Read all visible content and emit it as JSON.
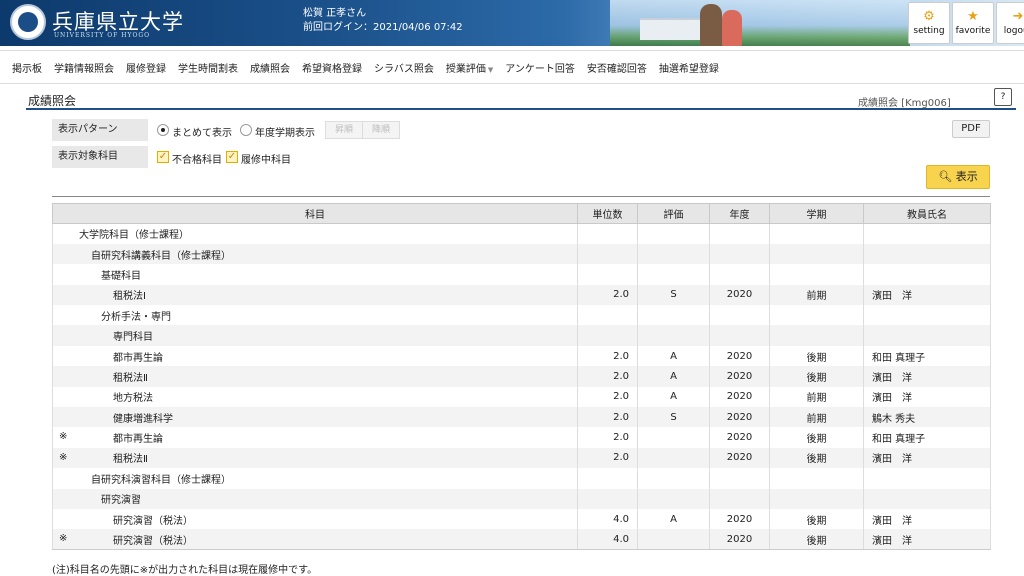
{
  "header": {
    "university": "兵庫県立大学",
    "university_sub": "UNIVERSITY OF HYOGO",
    "user_name": "松賀 正孝さん",
    "last_login": "前回ログイン：2021/04/06 07:42",
    "buttons": [
      {
        "label": "setting",
        "icon": "gear-icon"
      },
      {
        "label": "favorite",
        "icon": "star-icon"
      },
      {
        "label": "logout",
        "icon": "runner-icon"
      }
    ]
  },
  "nav": {
    "items": [
      "掲示板",
      "学籍情報照会",
      "履修登録",
      "学生時間割表",
      "成績照会",
      "希望資格登録",
      "シラバス照会",
      "授業評価",
      "アンケート回答",
      "安否確認回答",
      "抽選希望登録"
    ]
  },
  "page": {
    "title": "成績照会",
    "code": "成績照会 [Kmg006]"
  },
  "filters": {
    "pattern_label": "表示パターン",
    "opt_together": "まとめて表示",
    "opt_by_term": "年度学期表示",
    "asc": "昇順",
    "desc": "降順",
    "target_label": "表示対象科目",
    "chk_failed": "不合格科目",
    "chk_in_progress": "履修中科目",
    "pdf": "PDF",
    "show": "表示"
  },
  "table": {
    "headers": [
      "科目",
      "単位数",
      "評価",
      "年度",
      "学期",
      "教員氏名"
    ],
    "rows": [
      {
        "mark": "",
        "indent": 0,
        "subject": "大学院科目（修士課程）",
        "credits": "",
        "grade": "",
        "year": "",
        "term": "",
        "teacher": ""
      },
      {
        "mark": "",
        "indent": 1,
        "subject": "自研究科講義科目（修士課程）",
        "credits": "",
        "grade": "",
        "year": "",
        "term": "",
        "teacher": ""
      },
      {
        "mark": "",
        "indent": 2,
        "subject": "基礎科目",
        "credits": "",
        "grade": "",
        "year": "",
        "term": "",
        "teacher": ""
      },
      {
        "mark": "",
        "indent": 3,
        "subject": "租税法Ⅰ",
        "credits": "2.0",
        "grade": "S",
        "year": "2020",
        "term": "前期",
        "teacher": "濱田　洋"
      },
      {
        "mark": "",
        "indent": 2,
        "subject": "分析手法・専門",
        "credits": "",
        "grade": "",
        "year": "",
        "term": "",
        "teacher": ""
      },
      {
        "mark": "",
        "indent": 3,
        "subject": "専門科目",
        "credits": "",
        "grade": "",
        "year": "",
        "term": "",
        "teacher": ""
      },
      {
        "mark": "",
        "indent": 3,
        "subject": "都市再生論",
        "credits": "2.0",
        "grade": "A",
        "year": "2020",
        "term": "後期",
        "teacher": "和田 真理子"
      },
      {
        "mark": "",
        "indent": 3,
        "subject": "租税法Ⅱ",
        "credits": "2.0",
        "grade": "A",
        "year": "2020",
        "term": "後期",
        "teacher": "濱田　洋"
      },
      {
        "mark": "",
        "indent": 3,
        "subject": "地方税法",
        "credits": "2.0",
        "grade": "A",
        "year": "2020",
        "term": "前期",
        "teacher": "濱田　洋"
      },
      {
        "mark": "",
        "indent": 3,
        "subject": "健康増進科学",
        "credits": "2.0",
        "grade": "S",
        "year": "2020",
        "term": "前期",
        "teacher": "鵤木 秀夫"
      },
      {
        "mark": "※",
        "indent": 3,
        "subject": "都市再生論",
        "credits": "2.0",
        "grade": "",
        "year": "2020",
        "term": "後期",
        "teacher": "和田 真理子"
      },
      {
        "mark": "※",
        "indent": 3,
        "subject": "租税法Ⅱ",
        "credits": "2.0",
        "grade": "",
        "year": "2020",
        "term": "後期",
        "teacher": "濱田　洋"
      },
      {
        "mark": "",
        "indent": 1,
        "subject": "自研究科演習科目（修士課程）",
        "credits": "",
        "grade": "",
        "year": "",
        "term": "",
        "teacher": ""
      },
      {
        "mark": "",
        "indent": 2,
        "subject": "研究演習",
        "credits": "",
        "grade": "",
        "year": "",
        "term": "",
        "teacher": ""
      },
      {
        "mark": "",
        "indent": 3,
        "subject": "研究演習（税法）",
        "credits": "4.0",
        "grade": "A",
        "year": "2020",
        "term": "後期",
        "teacher": "濱田　洋"
      },
      {
        "mark": "※",
        "indent": 3,
        "subject": "研究演習（税法）",
        "credits": "4.0",
        "grade": "",
        "year": "2020",
        "term": "後期",
        "teacher": "濱田　洋"
      }
    ]
  },
  "footnote": "(注)科目名の先頭に※が出力された科目は現在履修中です。"
}
